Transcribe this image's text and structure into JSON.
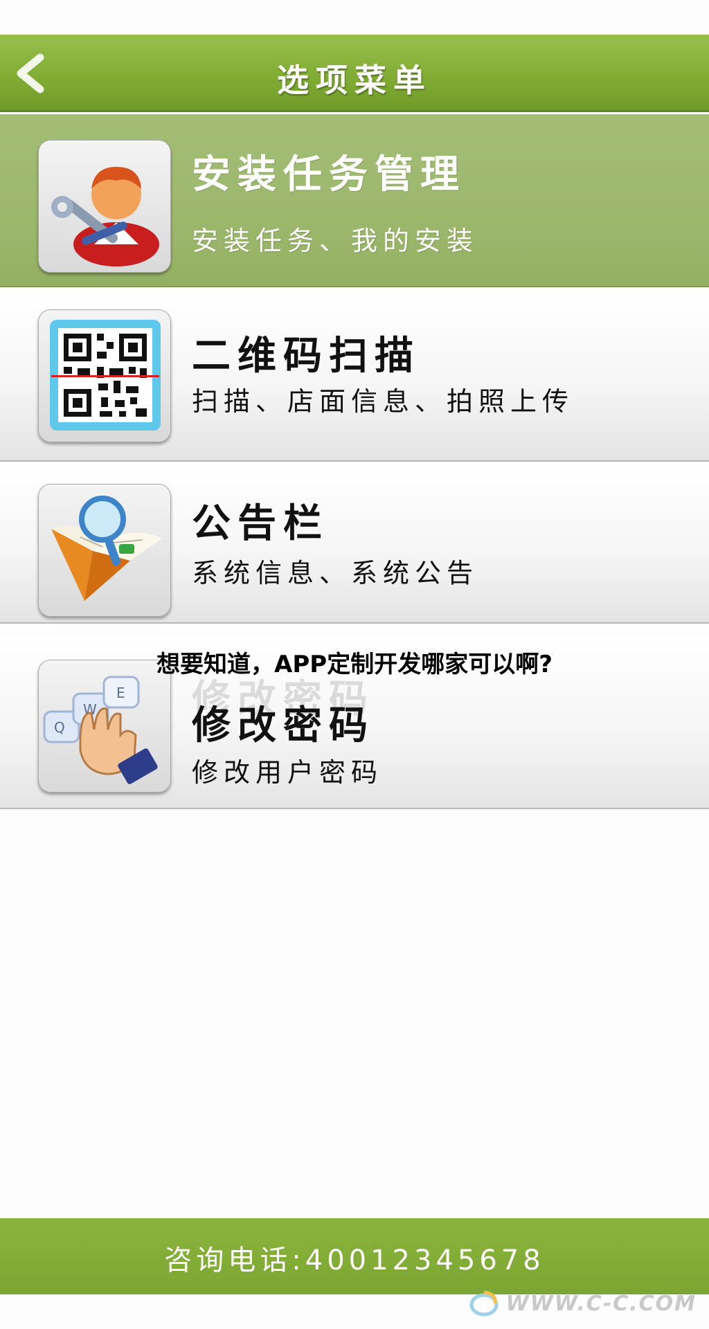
{
  "header": {
    "title": "选项菜单",
    "back_icon": "chevron-left-icon"
  },
  "menu": {
    "items": [
      {
        "title": "安装任务管理",
        "subtitle": "安装任务、我的安装",
        "icon": "installer-worker-icon",
        "active": true
      },
      {
        "title": "二维码扫描",
        "subtitle": "扫描、店面信息、拍照上传",
        "icon": "qr-code-icon",
        "active": false
      },
      {
        "title": "公告栏",
        "subtitle": "系统信息、系统公告",
        "icon": "book-magnifier-icon",
        "active": false
      },
      {
        "title": "修改密码",
        "subtitle": "修改用户密码",
        "icon": "keyboard-hand-icon",
        "active": false
      }
    ]
  },
  "overlay_caption": "想要知道，APP定制开发哪家可以啊?",
  "footer": {
    "text": "咨询电话:40012345678"
  },
  "watermark": {
    "text": "WWW.C-C.COM"
  },
  "colors": {
    "brand_green": "#82ad34",
    "active_row": "#9cb86d",
    "text_dark": "#111111"
  }
}
